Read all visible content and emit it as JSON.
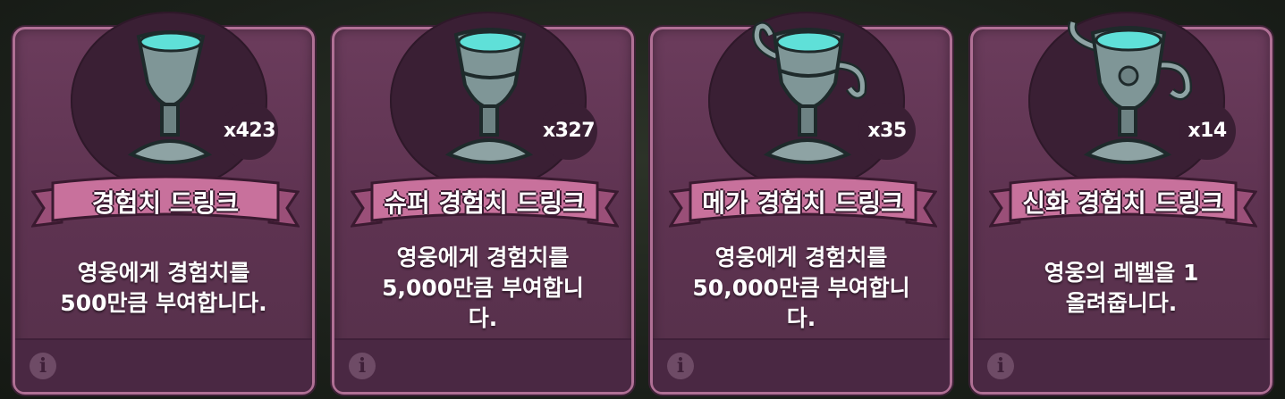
{
  "cards": [
    {
      "name": "경험치 드링크",
      "count": "x423",
      "description": "영웅에게 경험치를\n500만큼 부여합니다.",
      "icon": "exp-drink-goblet-icon"
    },
    {
      "name": "슈퍼 경험치 드링크",
      "count": "x327",
      "description": "영웅에게 경험치를\n5,000만큼 부여합니\n다.",
      "icon": "super-exp-drink-goblet-icon"
    },
    {
      "name": "메가 경험치 드링크",
      "count": "x35",
      "description": "영웅에게 경험치를\n50,000만큼 부여합니\n다.",
      "icon": "mega-exp-drink-trophy-icon"
    },
    {
      "name": "신화 경험치 드링크",
      "count": "x14",
      "description": "영웅의 레벨을 1\n올려줍니다.",
      "icon": "myth-exp-drink-trophy-icon"
    }
  ],
  "info_glyph": "i",
  "colors": {
    "card_bg": "#5e3351",
    "card_border": "#b07095",
    "ribbon": "#c8719c",
    "liquid": "#5fe0d8"
  }
}
